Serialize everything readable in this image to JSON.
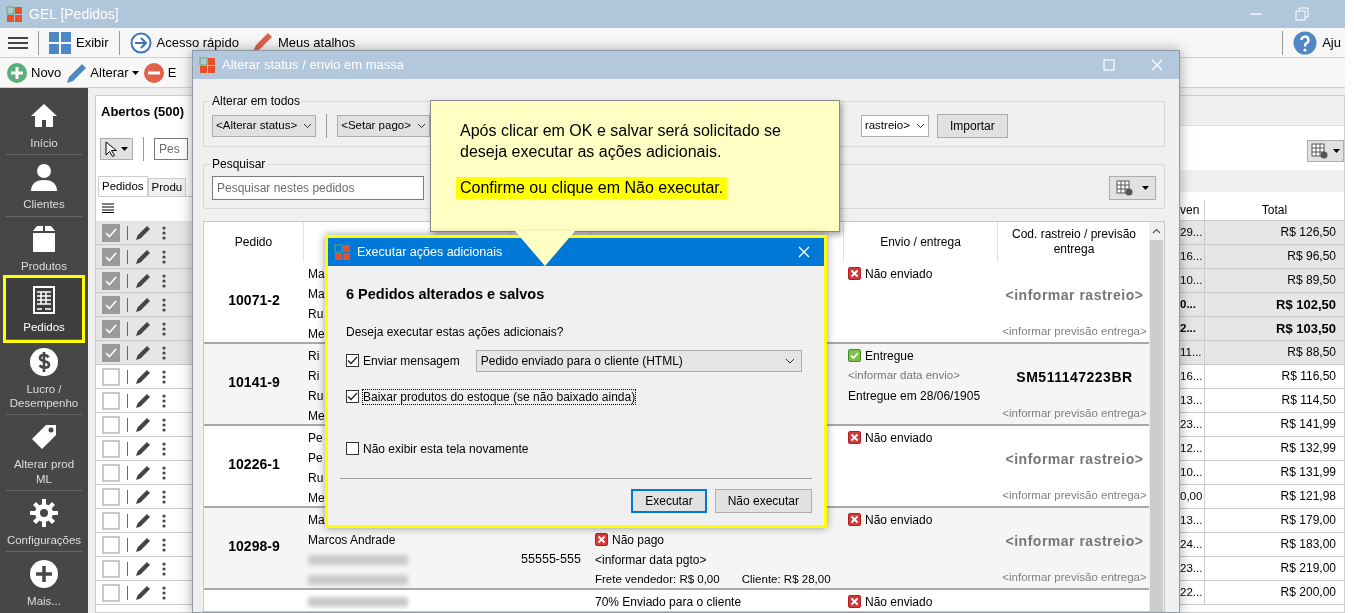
{
  "window": {
    "title": "GEL [Pedidos]",
    "help": "Aju"
  },
  "toolbar": [
    {
      "kind": "menu"
    },
    {
      "kind": "grid",
      "label": "Exibir"
    },
    {
      "kind": "arrow",
      "label": "Acesso rápido"
    },
    {
      "kind": "shortcut",
      "label": "Meus atalhos"
    }
  ],
  "actions": [
    {
      "kind": "add",
      "label": "Novo",
      "dropdown": false
    },
    {
      "kind": "edit",
      "label": "Alterar",
      "dropdown": true
    },
    {
      "kind": "remove",
      "label": "E",
      "dropdown": false
    }
  ],
  "sidebar": [
    {
      "label": "Início",
      "selected": false
    },
    {
      "label": "Clientes",
      "selected": false
    },
    {
      "label": "Produtos",
      "selected": false
    },
    {
      "label": "Pedidos",
      "selected": true
    },
    {
      "label": "Lucro / Desempenho",
      "selected": false
    },
    {
      "label": "Alterar prod ML",
      "selected": false
    },
    {
      "label": "Configurações",
      "selected": false
    },
    {
      "label": "Mais...",
      "selected": false
    }
  ],
  "list": {
    "title": "Abertos (500)",
    "search_placeholder": "Pes",
    "tabs": [
      {
        "label": "Pedidos",
        "selected": true
      },
      {
        "label": "Produ",
        "selected": false
      }
    ],
    "columns": [
      "ven",
      "Total"
    ],
    "rows": [
      {
        "checked": true,
        "bold": false,
        "column_1": "29...",
        "total": "R$ 126,50"
      },
      {
        "checked": true,
        "bold": false,
        "column_1": "16...",
        "total": "R$ 96,50"
      },
      {
        "checked": true,
        "bold": false,
        "column_1": "10...",
        "total": "R$ 89,50"
      },
      {
        "checked": true,
        "bold": true,
        "column_1": "0...",
        "total": "R$ 102,50"
      },
      {
        "checked": true,
        "bold": true,
        "column_1": "2...",
        "total": "R$ 103,50"
      },
      {
        "checked": true,
        "bold": false,
        "column_1": "11...",
        "total": "R$ 88,50"
      },
      {
        "checked": false,
        "bold": false,
        "column_1": "16...",
        "total": "R$ 116,50"
      },
      {
        "checked": false,
        "bold": false,
        "column_1": "13...",
        "total": "R$ 114,50"
      },
      {
        "checked": false,
        "bold": false,
        "column_1": "23...",
        "total": "R$ 141,99"
      },
      {
        "checked": false,
        "bold": false,
        "column_1": "12...",
        "total": "R$ 132,99"
      },
      {
        "checked": false,
        "bold": false,
        "column_1": "10...",
        "total": "R$ 131,99"
      },
      {
        "checked": false,
        "bold": false,
        "column_1": "0,00",
        "total": "R$ 121,98"
      },
      {
        "checked": false,
        "bold": false,
        "column_1": "13...",
        "total": "R$ 179,00"
      },
      {
        "checked": false,
        "bold": false,
        "column_1": "24...",
        "total": "R$ 183,00"
      },
      {
        "checked": false,
        "bold": false,
        "column_1": "23...",
        "total": "R$ 219,00"
      },
      {
        "checked": false,
        "bold": false,
        "column_1": "22...",
        "total": "R$ 200,00"
      }
    ]
  },
  "bulk_window": {
    "title": "Alterar status / envio em massa",
    "change_all": {
      "legend": "Alterar em todos",
      "status_select": "<Alterar status>",
      "paid_select": "<Setar pago>",
      "tracking_select": "rastreio>",
      "import_button": "Importar"
    },
    "search": {
      "legend": "Pesquisar",
      "placeholder": "Pesquisar nestes pedidos"
    },
    "columns": [
      "Pedido",
      "Envio / entrega",
      "Cod. rastreio / previsão entrega"
    ],
    "orders": [
      {
        "number": "10071-2",
        "client": [
          {
            "kind": "text",
            "text": "Ma"
          },
          {
            "kind": "text",
            "text": "Ma"
          },
          {
            "kind": "text",
            "text": "Ru"
          },
          {
            "kind": "text",
            "text": "Me"
          }
        ],
        "shipping": {
          "delivered": false,
          "label": "Não enviado"
        },
        "tracking": {
          "code": "<informar rastreio>",
          "informed": false
        },
        "forecast": "<informar previsão entrega>"
      },
      {
        "number": "10141-9",
        "client": [
          {
            "kind": "text",
            "text": "Ri"
          },
          {
            "kind": "text",
            "text": "Ri"
          },
          {
            "kind": "text",
            "text": "Ru"
          },
          {
            "kind": "text",
            "text": "Me"
          }
        ],
        "shipping": {
          "delivered": true,
          "label": "Entregue",
          "lines": [
            "<informar data envio>",
            "Entregue em 28/06/1905"
          ]
        },
        "tracking": {
          "code": "SM511147223BR",
          "informed": true
        },
        "forecast": "<informar previsão entrega>"
      },
      {
        "number": "10226-1",
        "client": [
          {
            "kind": "text",
            "text": "Pe"
          },
          {
            "kind": "text",
            "text": "Pe"
          },
          {
            "kind": "text",
            "text": "Ru"
          },
          {
            "kind": "text",
            "text": "Me"
          }
        ],
        "shipping": {
          "delivered": false,
          "label": "Não enviado"
        },
        "tracking": {
          "code": "<informar rastreio>",
          "informed": false
        },
        "forecast": "<informar previsão entrega>"
      },
      {
        "number": "10298-9",
        "client": [
          {
            "kind": "text",
            "text": "Ma"
          },
          {
            "kind": "text",
            "text": "Marcos Andrade"
          },
          {
            "kind": "blurred"
          },
          {
            "kind": "blurred"
          }
        ],
        "cep": "55555-555",
        "payment": {
          "paid": false,
          "label": "Não pago",
          "date": "<informar data pgto>",
          "freight": "Frete vendedor: R$ 0,00",
          "customer_freight": "Cliente: R$ 28,00"
        },
        "shipping": {
          "delivered": false,
          "label": "Não enviado"
        },
        "tracking": {
          "code": "<informar rastreio>",
          "informed": false
        },
        "forecast": "<informar previsão entrega>"
      },
      {
        "client": [
          {
            "kind": "blurred"
          }
        ],
        "status_line": "70% Enviado para o cliente",
        "shipping": {
          "delivered": false,
          "label": "Não enviado"
        }
      }
    ]
  },
  "callout": {
    "text": "Após clicar em OK e salvar será solicitado se deseja executar as ações adicionais.",
    "highlight": "Confirme ou clique em Não executar."
  },
  "actions_dialog": {
    "title": "Executar ações adicionais",
    "heading": "6 Pedidos alterados e salvos",
    "question": "Deseja executar estas ações adicionais?",
    "options": [
      {
        "kind": "message",
        "label": "Enviar mensagem",
        "checked": true,
        "select": "Pedido enviado para o cliente (HTML)",
        "focused": false
      },
      {
        "kind": "plain",
        "label": "Baixar produtos do estoque (se não baixado ainda)",
        "checked": true,
        "focused": true
      },
      {
        "kind": "plain",
        "label": "Não exibir esta tela novamente",
        "checked": false,
        "focused": false
      }
    ],
    "buttons": [
      {
        "label": "Executar",
        "default": true
      },
      {
        "label": "Não executar",
        "default": false
      }
    ]
  }
}
